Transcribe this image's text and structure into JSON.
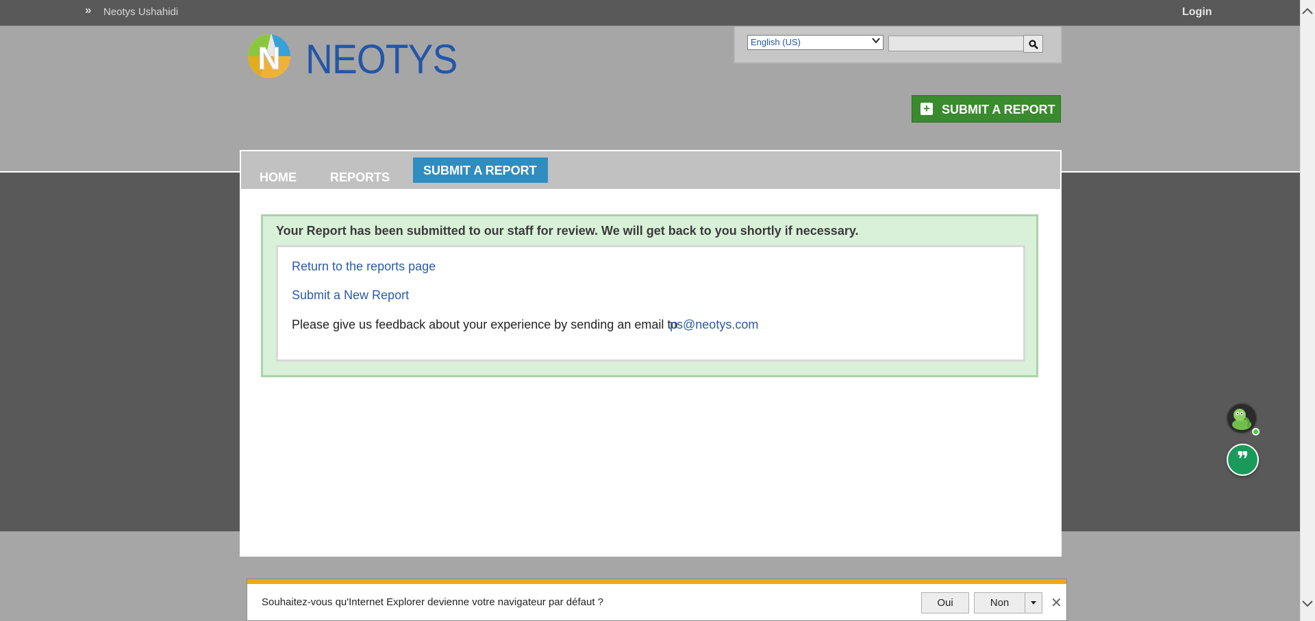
{
  "topbar": {
    "chevron": "»",
    "site_name": "Neotys Ushahidi",
    "login_label": "Login"
  },
  "logo": {
    "text": "NEOTYS"
  },
  "search": {
    "language_selected": "English (US)",
    "query": ""
  },
  "submit_top": {
    "label": "SUBMIT A REPORT"
  },
  "nav": {
    "items": [
      {
        "label": "HOME"
      },
      {
        "label": "REPORTS"
      },
      {
        "label": "SUBMIT A REPORT",
        "active": true
      }
    ]
  },
  "confirmation": {
    "message": "Your Report has been submitted to our staff for review. We will get back to you shortly if necessary.",
    "return_link": "Return to the reports page",
    "new_report_link": "Submit a New Report",
    "feedback_text": "Please give us feedback about your experience by sending an email to",
    "feedback_email": "ps@neotys.com"
  },
  "ie_notification": {
    "question": "Souhaitez-vous qu'Internet Explorer devienne votre navigateur par défaut ?",
    "yes_label": "Oui",
    "no_label": "Non"
  },
  "colors": {
    "brand_blue": "#2356a8",
    "submit_green": "#3a8a2e",
    "nav_active": "#2f8dc0",
    "success_bg": "#d9f0d9",
    "ie_stripe": "#f0a818"
  },
  "icons": [
    "double-chevron-icon",
    "neotys-logo-icon",
    "dropdown-arrow-icon",
    "search-icon",
    "plus-icon",
    "bot-avatar-icon",
    "chat-quote-icon",
    "close-icon",
    "scroll-up-icon",
    "scroll-down-icon"
  ]
}
